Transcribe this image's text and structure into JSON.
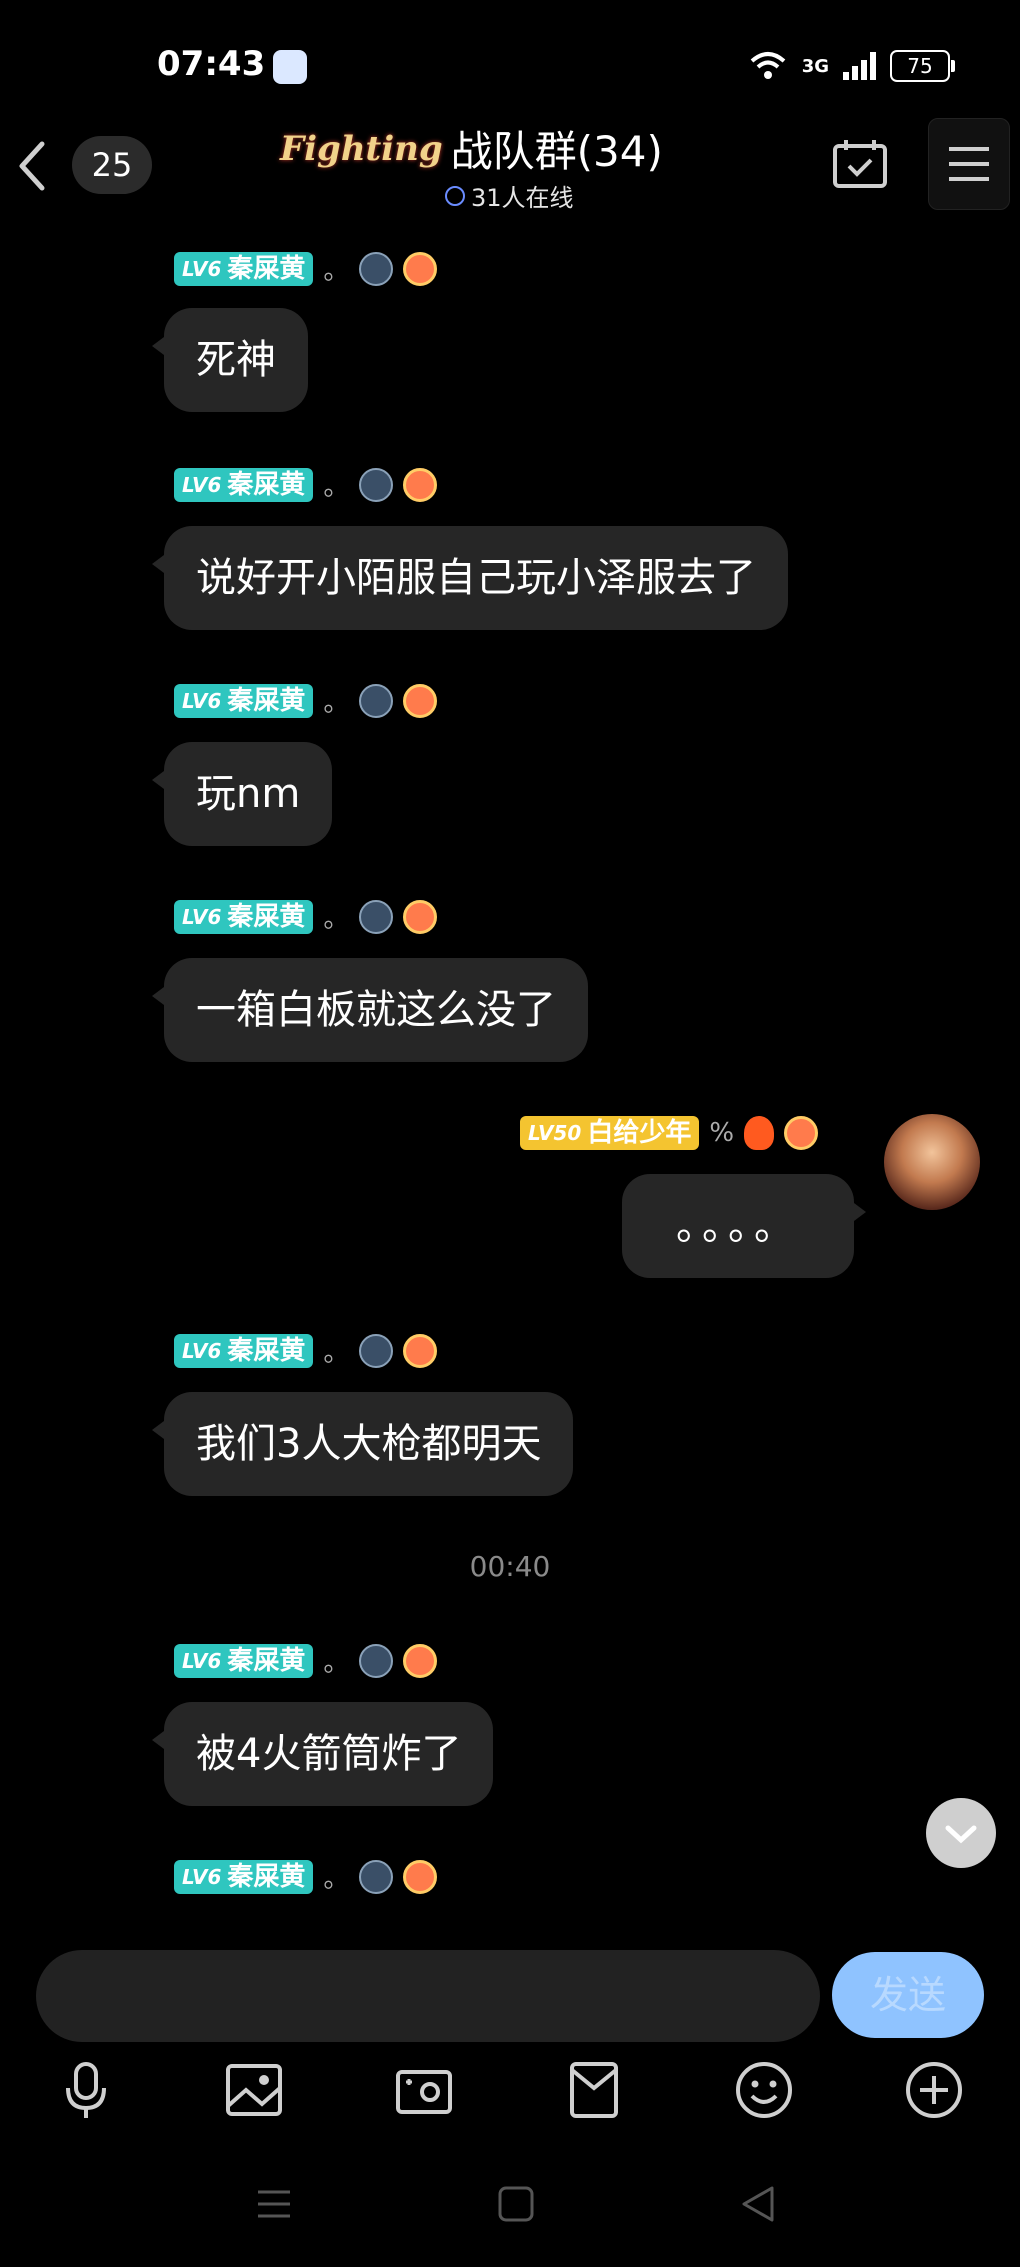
{
  "status_bar": {
    "time": "07:43",
    "network": "3G",
    "battery": "75"
  },
  "header": {
    "unread_count": "25",
    "title_logo": "Fighting",
    "title": "战队群(34)",
    "online": "31人在线"
  },
  "messages": [
    {
      "side": "left",
      "level": "LV6",
      "sender": "秦屎黄",
      "suffix": "。",
      "text": "死神"
    },
    {
      "side": "left",
      "level": "LV6",
      "sender": "秦屎黄",
      "suffix": "。",
      "text": "说好开小陌服自己玩小泽服去了"
    },
    {
      "side": "left",
      "level": "LV6",
      "sender": "秦屎黄",
      "suffix": "。",
      "text": "玩nm"
    },
    {
      "side": "left",
      "level": "LV6",
      "sender": "秦屎黄",
      "suffix": "。",
      "text": "一箱白板就这么没了"
    },
    {
      "side": "right",
      "level": "LV50",
      "sender": "白给少年",
      "suffix": "%",
      "text": "。。。。"
    },
    {
      "side": "left",
      "level": "LV6",
      "sender": "秦屎黄",
      "suffix": "。",
      "text": "我们3人大枪都明天"
    },
    {
      "side": "left",
      "level": "LV6",
      "sender": "秦屎黄",
      "suffix": "。",
      "text": "被4火箭筒炸了"
    },
    {
      "side": "left",
      "level": "LV6",
      "sender": "秦屎黄",
      "suffix": "。",
      "text": ""
    }
  ],
  "timestamp": "00:40",
  "input": {
    "value": "",
    "send_label": "发送"
  },
  "toolbar": [
    "microphone-icon",
    "image-icon",
    "camera-icon",
    "red-packet-icon",
    "emoji-icon",
    "plus-icon"
  ],
  "colors": {
    "level_teal": "#2fc6bf",
    "level_yellow": "#f4c430",
    "send_button": "#8fc3ff",
    "bubble": "#262626"
  }
}
